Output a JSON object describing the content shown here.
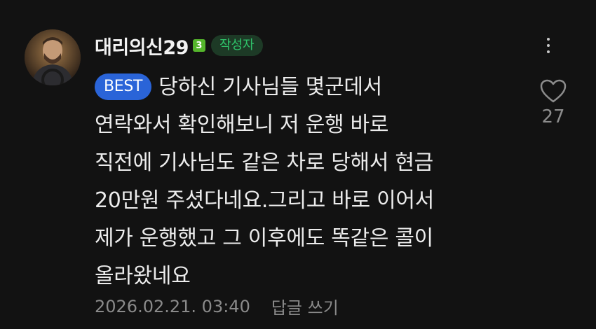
{
  "comment": {
    "nickname": "대리의신29",
    "level": "3",
    "author_badge": "작성자",
    "best_badge": "BEST",
    "lines": [
      "당하신 기사님들 몇군데서",
      "연락와서 확인해보니 저 운행 바로",
      "직전에 기사님도 같은 차로 당해서 현금",
      "20만원 주셨다네요.그리고 바로 이어서",
      "제가 운행했고 그 이후에도 똑같은 콜이",
      "올라왔네요"
    ],
    "like_count": "27",
    "date": "2026.02.21. 03:40",
    "reply_label": "답글 쓰기"
  },
  "colors": {
    "background": "#121212",
    "best_badge": "#2a64d8",
    "author_badge_text": "#2fc36a",
    "level_badge": "#55b52c"
  },
  "icons": {
    "more": "more-vertical-icon",
    "like": "heart-outline-icon",
    "level": "level-badge-icon"
  }
}
